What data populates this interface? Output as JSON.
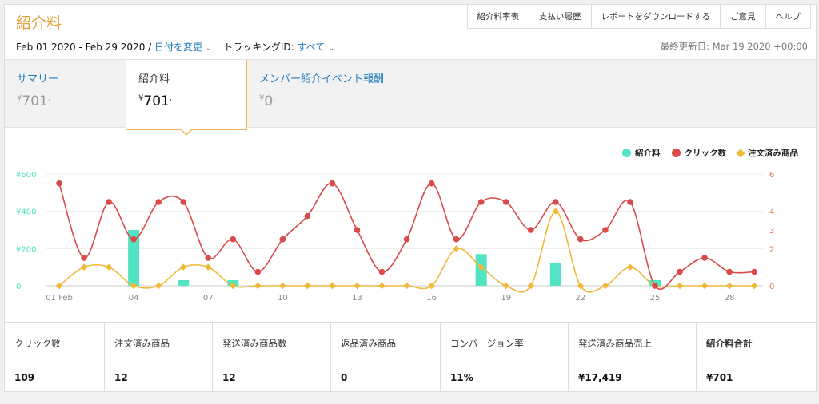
{
  "header": {
    "title": "紹介料"
  },
  "nav": [
    "紹介料率表",
    "支払い履歴",
    "レポートをダウンロードする",
    "ご意見",
    "ヘルプ"
  ],
  "filter": {
    "date_range": "Feb 01 2020 - Feb 29 2020 /",
    "change_date": "日付を変更",
    "tracking_label": "トラッキングID:",
    "tracking_value": "すべて"
  },
  "last_updated": "最終更新日: Mar 19 2020 +00:00",
  "tabs": [
    {
      "label": "サマリー",
      "currency": "¥",
      "value": "701",
      "suffix": "."
    },
    {
      "label": "紹介料",
      "currency": "¥",
      "value": "701",
      "suffix": "."
    },
    {
      "label": "メンバー紹介イベント報酬",
      "currency": "¥",
      "value": "0",
      "suffix": "."
    }
  ],
  "legend": [
    "紹介料",
    "クリック数",
    "注文済み商品"
  ],
  "colors": {
    "fees": "#52e3c2",
    "clicks": "#d94a4a",
    "orders": "#f0b93a",
    "accent": "#e8a13a",
    "link": "#1f7bbf"
  },
  "chart_data": {
    "type": "bar+line",
    "x": [
      1,
      2,
      3,
      4,
      5,
      6,
      7,
      8,
      9,
      10,
      11,
      12,
      13,
      14,
      15,
      16,
      17,
      18,
      19,
      20,
      21,
      22,
      23,
      24,
      25,
      26,
      27,
      28,
      29
    ],
    "x_tick_labels": [
      "01 Feb",
      "04",
      "07",
      "10",
      "13",
      "16",
      "19",
      "22",
      "25",
      "28"
    ],
    "y_left_ticks": [
      "¥600",
      "¥400",
      "¥200",
      "0"
    ],
    "y_left_range": [
      0,
      600
    ],
    "y_right_ticks": [
      "6",
      "4",
      "3",
      "2",
      "0"
    ],
    "y_right_range": [
      0,
      6
    ],
    "series": [
      {
        "name": "紹介料",
        "type": "bar",
        "axis": "left",
        "values": [
          0,
          0,
          0,
          300,
          0,
          30,
          0,
          30,
          0,
          0,
          0,
          0,
          0,
          0,
          0,
          0,
          0,
          170,
          0,
          0,
          120,
          0,
          0,
          0,
          30,
          0,
          0,
          0,
          0
        ]
      },
      {
        "name": "クリック数",
        "type": "line",
        "axis": "right",
        "values": [
          5.5,
          1.5,
          4.5,
          2.5,
          4.5,
          4.5,
          1.5,
          2.5,
          0.75,
          2.5,
          3.75,
          5.5,
          3,
          0.75,
          2.5,
          5.5,
          2.5,
          4.5,
          4.5,
          3,
          4.5,
          2.5,
          3,
          4.5,
          0,
          0.75,
          1.5,
          0.75,
          0.75
        ]
      },
      {
        "name": "注文済み商品",
        "type": "line",
        "axis": "right",
        "values": [
          0,
          1,
          1,
          0,
          0,
          1,
          1,
          0,
          0,
          0,
          0,
          0,
          0,
          0,
          0,
          0,
          2,
          1,
          0,
          0,
          4,
          0,
          0,
          1,
          0,
          0,
          0,
          0,
          0
        ]
      }
    ]
  },
  "stats": [
    {
      "label": "クリック数",
      "value": "109"
    },
    {
      "label": "注文済み商品",
      "value": "12"
    },
    {
      "label": "発送済み商品数",
      "value": "12"
    },
    {
      "label": "返品済み商品",
      "value": "0"
    },
    {
      "label": "コンバージョン率",
      "value": "11%"
    },
    {
      "label": "発送済み商品売上",
      "value": "¥17,419"
    },
    {
      "label": "紹介料合計",
      "value": "¥701"
    }
  ]
}
